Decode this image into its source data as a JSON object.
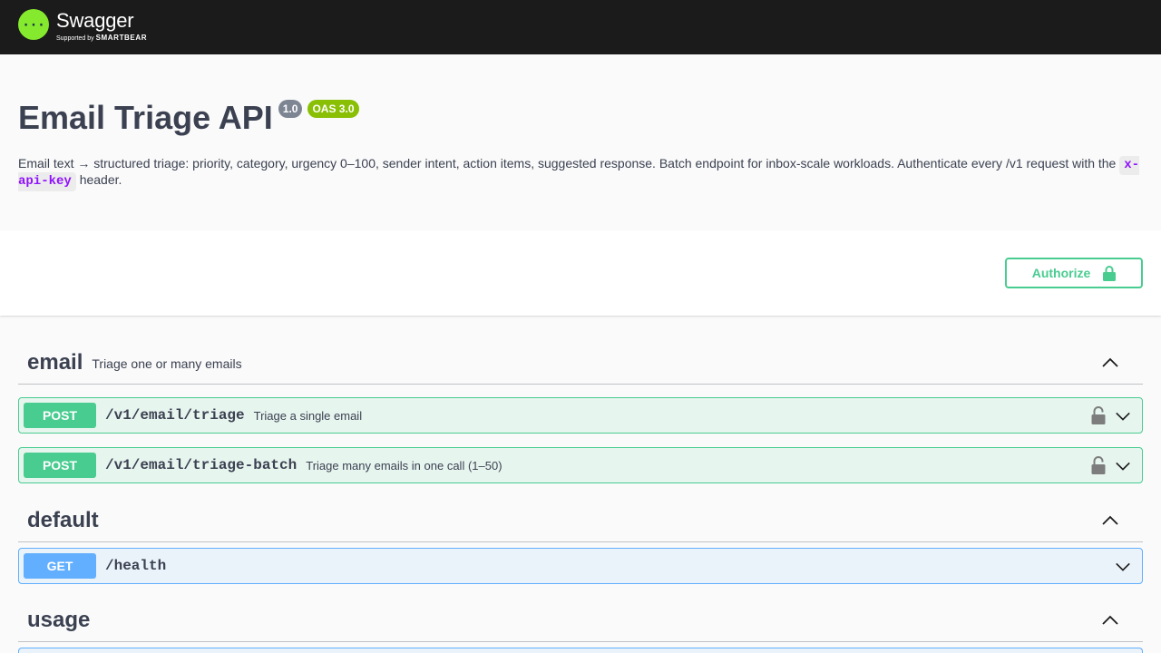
{
  "brand": {
    "name": "Swagger",
    "supported_prefix": "Supported by",
    "supported_by": "SMARTBEAR",
    "logo_glyph": "{···}"
  },
  "info": {
    "title": "Email Triage API",
    "version": "1.0",
    "oas": "OAS 3.0",
    "description_text": "Email text → structured triage: priority, category, urgency 0–100, sender intent, action items, suggested response. Batch endpoint for inbox-scale workloads. Authenticate every /v1 request with the",
    "description_code": "x-api-key",
    "description_suffix": "header."
  },
  "auth": {
    "label": "Authorize"
  },
  "tags": [
    {
      "name": "email",
      "description": "Triage one or many emails"
    },
    {
      "name": "default",
      "description": ""
    },
    {
      "name": "usage",
      "description": ""
    }
  ],
  "operations": [
    {
      "method": "POST",
      "path": "/v1/email/triage",
      "summary": "Triage a single email"
    },
    {
      "method": "POST",
      "path": "/v1/email/triage-batch",
      "summary": "Triage many emails in one call (1–50)"
    },
    {
      "method": "GET",
      "path": "/health",
      "summary": ""
    }
  ],
  "colors": {
    "post": "#49cc90",
    "get": "#61affe",
    "topbar": "#1b1b1b",
    "logo": "#85ea2d",
    "version_badge": "#7d8492",
    "oas_badge": "#89bf04",
    "code": "#9012fe"
  }
}
